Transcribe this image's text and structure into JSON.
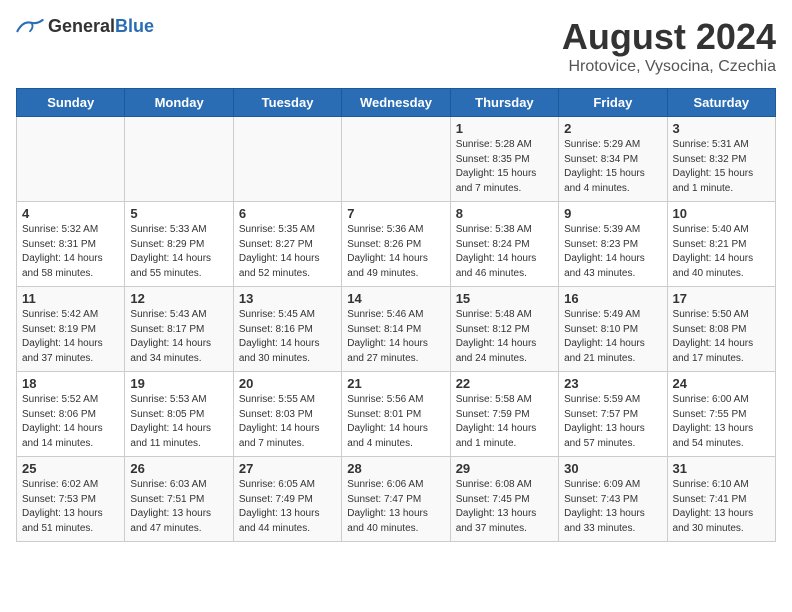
{
  "header": {
    "logo_general": "General",
    "logo_blue": "Blue",
    "month_title": "August 2024",
    "location": "Hrotovice, Vysocina, Czechia"
  },
  "days_of_week": [
    "Sunday",
    "Monday",
    "Tuesday",
    "Wednesday",
    "Thursday",
    "Friday",
    "Saturday"
  ],
  "weeks": [
    [
      {
        "day": "",
        "info": ""
      },
      {
        "day": "",
        "info": ""
      },
      {
        "day": "",
        "info": ""
      },
      {
        "day": "",
        "info": ""
      },
      {
        "day": "1",
        "info": "Sunrise: 5:28 AM\nSunset: 8:35 PM\nDaylight: 15 hours\nand 7 minutes."
      },
      {
        "day": "2",
        "info": "Sunrise: 5:29 AM\nSunset: 8:34 PM\nDaylight: 15 hours\nand 4 minutes."
      },
      {
        "day": "3",
        "info": "Sunrise: 5:31 AM\nSunset: 8:32 PM\nDaylight: 15 hours\nand 1 minute."
      }
    ],
    [
      {
        "day": "4",
        "info": "Sunrise: 5:32 AM\nSunset: 8:31 PM\nDaylight: 14 hours\nand 58 minutes."
      },
      {
        "day": "5",
        "info": "Sunrise: 5:33 AM\nSunset: 8:29 PM\nDaylight: 14 hours\nand 55 minutes."
      },
      {
        "day": "6",
        "info": "Sunrise: 5:35 AM\nSunset: 8:27 PM\nDaylight: 14 hours\nand 52 minutes."
      },
      {
        "day": "7",
        "info": "Sunrise: 5:36 AM\nSunset: 8:26 PM\nDaylight: 14 hours\nand 49 minutes."
      },
      {
        "day": "8",
        "info": "Sunrise: 5:38 AM\nSunset: 8:24 PM\nDaylight: 14 hours\nand 46 minutes."
      },
      {
        "day": "9",
        "info": "Sunrise: 5:39 AM\nSunset: 8:23 PM\nDaylight: 14 hours\nand 43 minutes."
      },
      {
        "day": "10",
        "info": "Sunrise: 5:40 AM\nSunset: 8:21 PM\nDaylight: 14 hours\nand 40 minutes."
      }
    ],
    [
      {
        "day": "11",
        "info": "Sunrise: 5:42 AM\nSunset: 8:19 PM\nDaylight: 14 hours\nand 37 minutes."
      },
      {
        "day": "12",
        "info": "Sunrise: 5:43 AM\nSunset: 8:17 PM\nDaylight: 14 hours\nand 34 minutes."
      },
      {
        "day": "13",
        "info": "Sunrise: 5:45 AM\nSunset: 8:16 PM\nDaylight: 14 hours\nand 30 minutes."
      },
      {
        "day": "14",
        "info": "Sunrise: 5:46 AM\nSunset: 8:14 PM\nDaylight: 14 hours\nand 27 minutes."
      },
      {
        "day": "15",
        "info": "Sunrise: 5:48 AM\nSunset: 8:12 PM\nDaylight: 14 hours\nand 24 minutes."
      },
      {
        "day": "16",
        "info": "Sunrise: 5:49 AM\nSunset: 8:10 PM\nDaylight: 14 hours\nand 21 minutes."
      },
      {
        "day": "17",
        "info": "Sunrise: 5:50 AM\nSunset: 8:08 PM\nDaylight: 14 hours\nand 17 minutes."
      }
    ],
    [
      {
        "day": "18",
        "info": "Sunrise: 5:52 AM\nSunset: 8:06 PM\nDaylight: 14 hours\nand 14 minutes."
      },
      {
        "day": "19",
        "info": "Sunrise: 5:53 AM\nSunset: 8:05 PM\nDaylight: 14 hours\nand 11 minutes."
      },
      {
        "day": "20",
        "info": "Sunrise: 5:55 AM\nSunset: 8:03 PM\nDaylight: 14 hours\nand 7 minutes."
      },
      {
        "day": "21",
        "info": "Sunrise: 5:56 AM\nSunset: 8:01 PM\nDaylight: 14 hours\nand 4 minutes."
      },
      {
        "day": "22",
        "info": "Sunrise: 5:58 AM\nSunset: 7:59 PM\nDaylight: 14 hours\nand 1 minute."
      },
      {
        "day": "23",
        "info": "Sunrise: 5:59 AM\nSunset: 7:57 PM\nDaylight: 13 hours\nand 57 minutes."
      },
      {
        "day": "24",
        "info": "Sunrise: 6:00 AM\nSunset: 7:55 PM\nDaylight: 13 hours\nand 54 minutes."
      }
    ],
    [
      {
        "day": "25",
        "info": "Sunrise: 6:02 AM\nSunset: 7:53 PM\nDaylight: 13 hours\nand 51 minutes."
      },
      {
        "day": "26",
        "info": "Sunrise: 6:03 AM\nSunset: 7:51 PM\nDaylight: 13 hours\nand 47 minutes."
      },
      {
        "day": "27",
        "info": "Sunrise: 6:05 AM\nSunset: 7:49 PM\nDaylight: 13 hours\nand 44 minutes."
      },
      {
        "day": "28",
        "info": "Sunrise: 6:06 AM\nSunset: 7:47 PM\nDaylight: 13 hours\nand 40 minutes."
      },
      {
        "day": "29",
        "info": "Sunrise: 6:08 AM\nSunset: 7:45 PM\nDaylight: 13 hours\nand 37 minutes."
      },
      {
        "day": "30",
        "info": "Sunrise: 6:09 AM\nSunset: 7:43 PM\nDaylight: 13 hours\nand 33 minutes."
      },
      {
        "day": "31",
        "info": "Sunrise: 6:10 AM\nSunset: 7:41 PM\nDaylight: 13 hours\nand 30 minutes."
      }
    ]
  ]
}
